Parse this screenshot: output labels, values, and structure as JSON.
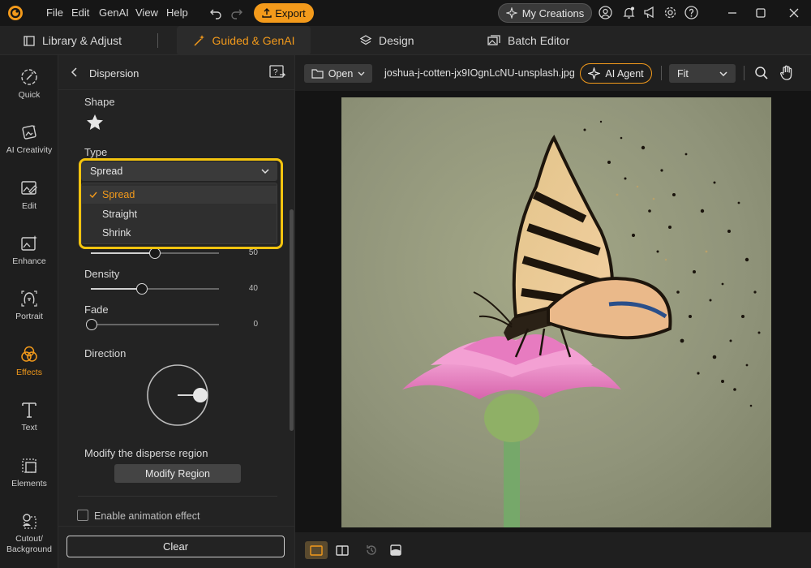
{
  "menu": {
    "file": "File",
    "edit": "Edit",
    "genai": "GenAI",
    "view": "View",
    "help": "Help"
  },
  "titlebar": {
    "export_label": "Export",
    "my_creations_label": "My Creations"
  },
  "tabs": [
    {
      "label": "Library & Adjust",
      "icon": "library-icon"
    },
    {
      "label": "Guided & GenAI",
      "icon": "magic-wand-icon",
      "active": true
    },
    {
      "label": "Design",
      "icon": "layers-icon"
    },
    {
      "label": "Batch Editor",
      "icon": "batch-images-icon"
    }
  ],
  "sidebar": {
    "items": [
      {
        "label": "Quick",
        "icon": "quick-wand-icon"
      },
      {
        "label": "AI Creativity",
        "icon": "ai-creativity-icon"
      },
      {
        "label": "Edit",
        "icon": "edit-image-icon"
      },
      {
        "label": "Enhance",
        "icon": "enhance-sparkle-icon"
      },
      {
        "label": "Portrait",
        "icon": "portrait-face-icon"
      },
      {
        "label": "Effects",
        "icon": "effects-circles-icon",
        "active": true
      },
      {
        "label": "Text",
        "icon": "text-t-icon"
      },
      {
        "label": "Elements",
        "icon": "elements-grid-icon"
      },
      {
        "label": "Cutout/ Background",
        "icon": "cutout-icon"
      }
    ]
  },
  "panel": {
    "title": "Dispersion",
    "shape_label": "Shape",
    "type_label": "Type",
    "type_selected": "Spread",
    "type_options": [
      "Spread",
      "Straight",
      "Shrink"
    ],
    "sliders": [
      {
        "label": "",
        "value": "50",
        "fraction": 0.5
      },
      {
        "label": "Density",
        "value": "40",
        "fraction": 0.4
      },
      {
        "label": "Fade",
        "value": "0",
        "fraction": 0.0
      }
    ],
    "direction_label": "Direction",
    "modify_region_title": "Modify the disperse region",
    "modify_region_button": "Modify Region",
    "animation_label": "Enable animation effect",
    "clear_label": "Clear"
  },
  "toolbar": {
    "open_label": "Open",
    "filename": "joshua-j-cotten-jx9IOgnLcNU-unsplash.jpg",
    "ai_agent_label": "AI Agent",
    "zoom_value": "Fit"
  },
  "colors": {
    "accent": "#f39a1b",
    "highlight": "#f4c40f"
  }
}
